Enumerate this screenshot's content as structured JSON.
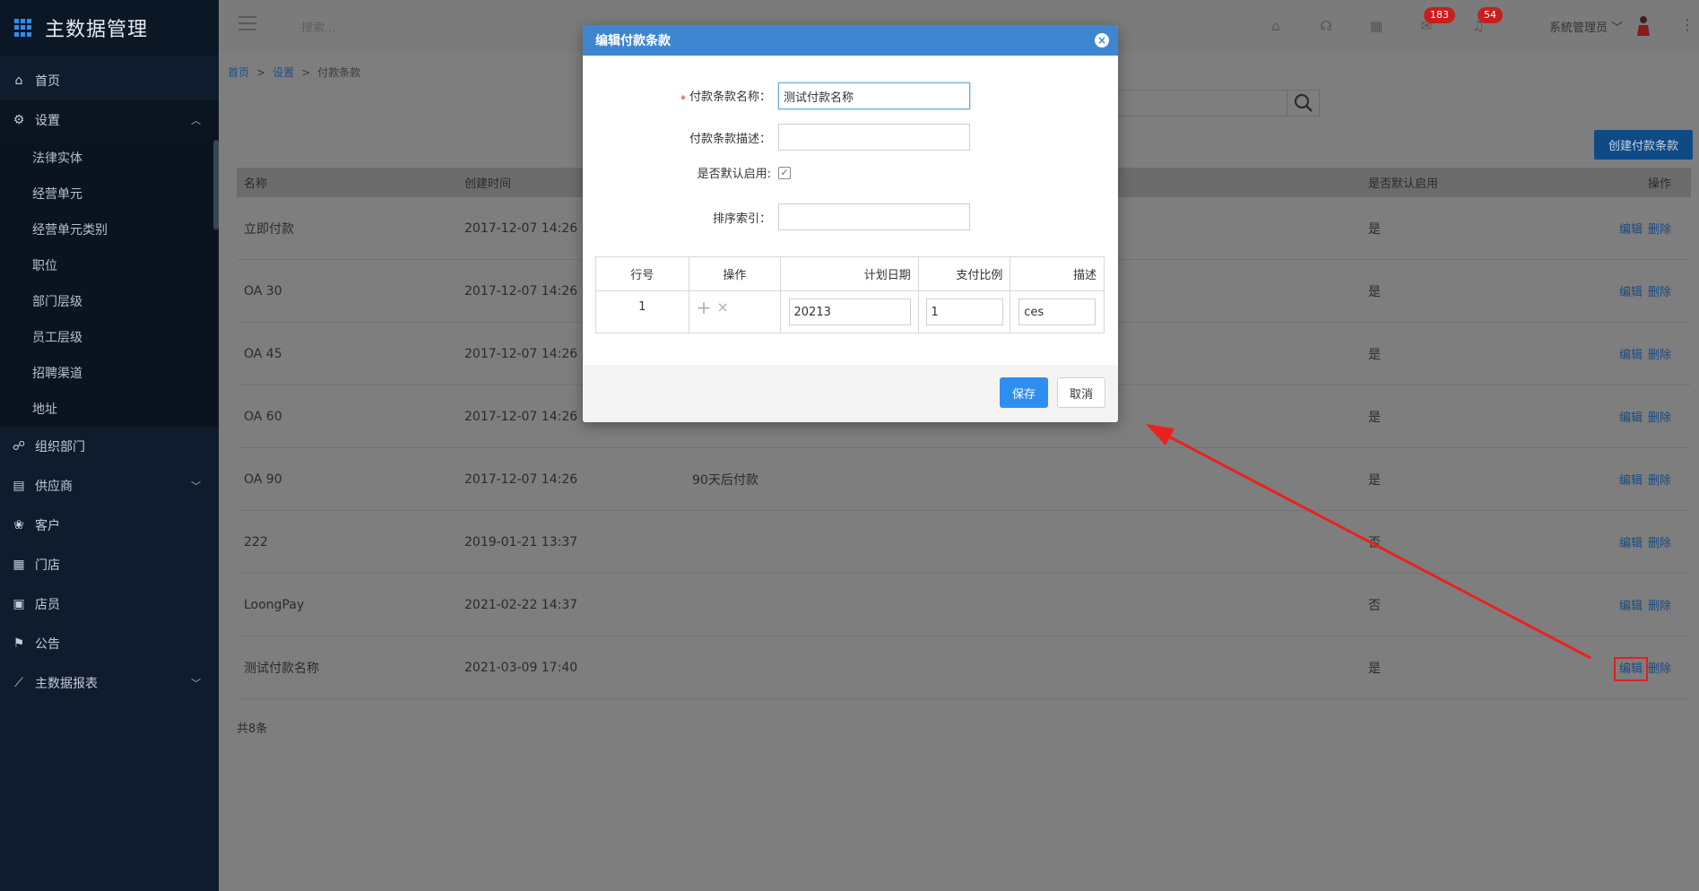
{
  "app": {
    "title": "主数据管理"
  },
  "sidebar": {
    "items": [
      {
        "label": "首页",
        "icon": "home-icon"
      },
      {
        "label": "设置",
        "icon": "gear-icon",
        "expanded": true
      },
      {
        "label": "组织部门",
        "icon": "org-icon"
      },
      {
        "label": "供应商",
        "icon": "supplier-icon",
        "has_children": true
      },
      {
        "label": "客户",
        "icon": "customer-icon"
      },
      {
        "label": "门店",
        "icon": "store-icon"
      },
      {
        "label": "店员",
        "icon": "clerk-icon"
      },
      {
        "label": "公告",
        "icon": "notice-icon"
      },
      {
        "label": "主数据报表",
        "icon": "report-icon",
        "has_children": true
      }
    ],
    "settings_sub": [
      "法律实体",
      "经营单元",
      "经营单元类别",
      "职位",
      "部门层级",
      "员工层级",
      "招聘渠道",
      "地址"
    ]
  },
  "header": {
    "search_placeholder": "搜索...",
    "badge_messages": "183",
    "badge_notifications": "54",
    "user": "系統管理员"
  },
  "breadcrumb": {
    "home": "首页",
    "settings": "设置",
    "current": "付款条款",
    "sep": ">"
  },
  "toolbar": {
    "create_label": "创建付款条款"
  },
  "table": {
    "headers": {
      "name": "名称",
      "created": "创建时间",
      "default": "是否默认启用",
      "actions": "操作"
    },
    "rows": [
      {
        "name": "立即付款",
        "created": "2017-12-07 14:26",
        "desc": "",
        "default": "是"
      },
      {
        "name": "OA 30",
        "created": "2017-12-07 14:26",
        "desc": "",
        "default": "是"
      },
      {
        "name": "OA 45",
        "created": "2017-12-07 14:26",
        "desc": "",
        "default": "是"
      },
      {
        "name": "OA 60",
        "created": "2017-12-07 14:26",
        "desc": "",
        "default": "是"
      },
      {
        "name": "OA 90",
        "created": "2017-12-07 14:26",
        "desc": "90天后付款",
        "default": "是"
      },
      {
        "name": "222",
        "created": "2019-01-21 13:37",
        "desc": "",
        "default": "否"
      },
      {
        "name": "LoongPay",
        "created": "2021-02-22 14:37",
        "desc": "",
        "default": "否"
      },
      {
        "name": "测试付款名称",
        "created": "2021-03-09 17:40",
        "desc": "",
        "default": "是"
      }
    ],
    "edit_label": "编辑",
    "delete_label": "删除",
    "total": "共8条"
  },
  "modal": {
    "title": "编辑付款条款",
    "close_icon": "close-icon",
    "fields": {
      "name_label": "付款条款名称：",
      "name_value": "测试付款名称",
      "desc_label": "付款条款描述：",
      "desc_value": "",
      "default_label": "是否默认启用:",
      "default_checked": true,
      "sort_label": "排序索引：",
      "sort_value": ""
    },
    "lines": {
      "headers": [
        "行号",
        "操作",
        "计划日期",
        "支付比例",
        "描述"
      ],
      "rows": [
        {
          "no": "1",
          "date": "20213",
          "ratio": "1",
          "desc": "ces"
        }
      ]
    },
    "save_label": "保存",
    "cancel_label": "取消"
  },
  "colors": {
    "accent": "#2f8ff0",
    "header_blue": "#3e86d1",
    "sidebar": "#0f1c2e",
    "highlight": "#e02020"
  }
}
